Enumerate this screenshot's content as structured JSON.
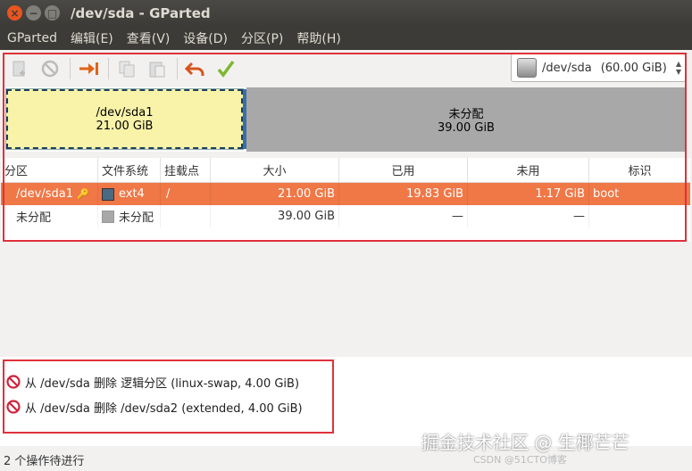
{
  "window": {
    "title": "/dev/sda - GParted",
    "controls": {
      "close": "×",
      "minimize": "−",
      "maximize": "□"
    }
  },
  "menu": [
    "GParted",
    "编辑(E)",
    "查看(V)",
    "设备(D)",
    "分区(P)",
    "帮助(H)"
  ],
  "toolbar": {
    "icons": [
      "new-icon",
      "delete-icon",
      "resize-move-icon",
      "copy-icon",
      "paste-icon",
      "undo-icon",
      "apply-icon"
    ],
    "device": {
      "path": "/dev/sda",
      "size": "(60.00 GiB)"
    }
  },
  "diskmap": {
    "partitions": [
      {
        "name": "/dev/sda1",
        "size": "21.00 GiB",
        "color": "#f8f3a9",
        "size_gib": 21.0
      },
      {
        "name": "未分配",
        "size": "39.00 GiB",
        "color": "#a8a8a8",
        "size_gib": 39.0
      }
    ]
  },
  "table": {
    "headers": [
      "分区",
      "文件系统",
      "挂载点",
      "大小",
      "已用",
      "未用",
      "标识"
    ],
    "rows": [
      {
        "partition": "/dev/sda1",
        "fs": "ext4",
        "fs_color": "#4b6983",
        "mount": "/",
        "size": "21.00 GiB",
        "used": "19.83 GiB",
        "unused": "1.17 GiB",
        "flags": "boot",
        "selected": true
      },
      {
        "partition": "未分配",
        "fs": "未分配",
        "fs_color": "#a8a8a8",
        "mount": "",
        "size": "39.00 GiB",
        "used": "—",
        "unused": "—",
        "flags": "",
        "selected": false
      }
    ]
  },
  "operations": [
    "从 /dev/sda 删除 逻辑分区 (linux-swap, 4.00 GiB)",
    "从 /dev/sda 删除 /dev/sda2 (extended, 4.00 GiB)"
  ],
  "status": "2 个操作待进行",
  "watermark": {
    "main": "掘金技术社区 @ 生椰芒芒",
    "sub": "CSDN @51CTO博客"
  }
}
